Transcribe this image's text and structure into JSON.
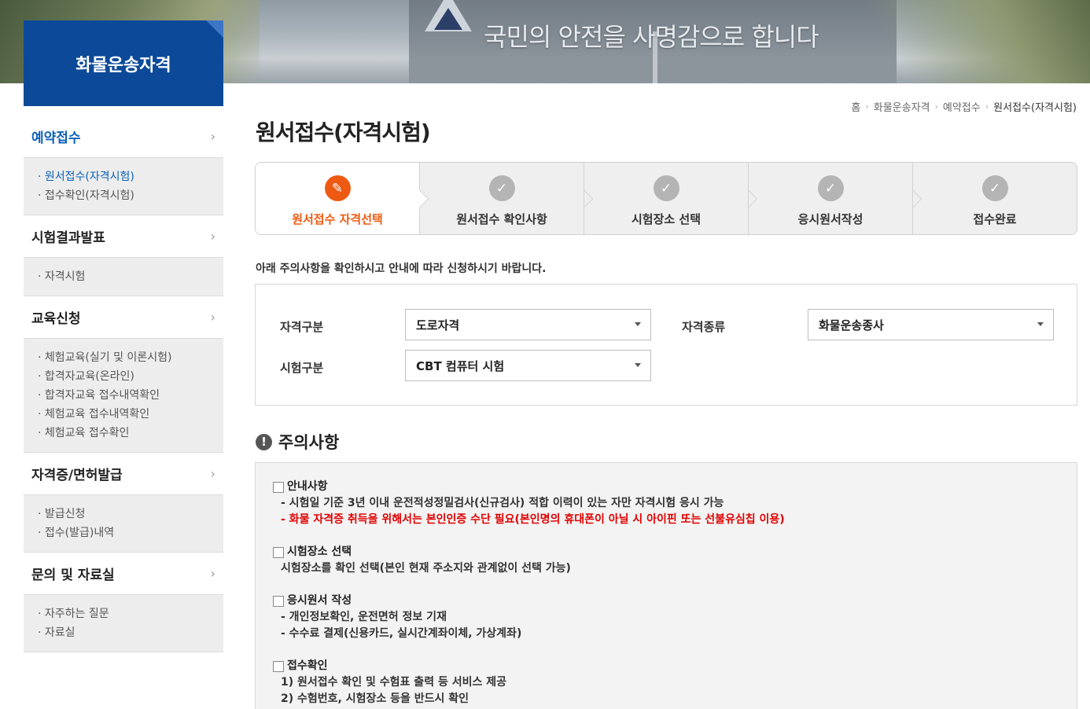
{
  "banner": {
    "slogan": "국민의 안전을 사명감으로 합니다"
  },
  "sidebar": {
    "title": "화물운송자격",
    "sections": [
      {
        "label": "예약접수",
        "items": [
          "원서접수(자격시험)",
          "접수확인(자격시험)"
        ]
      },
      {
        "label": "시험결과발표",
        "items": [
          "자격시험"
        ]
      },
      {
        "label": "교육신청",
        "items": [
          "체험교육(실기 및 이론시험)",
          "합격자교육(온라인)",
          "합격자교육 접수내역확인",
          "체험교육 접수내역확인",
          "체험교육 접수확인"
        ]
      },
      {
        "label": "자격증/면허발급",
        "items": [
          "발급신청",
          "접수(발급)내역"
        ]
      },
      {
        "label": "문의 및 자료실",
        "items": [
          "자주하는 질문",
          "자료실"
        ]
      }
    ]
  },
  "breadcrumb": [
    "홈",
    "화물운송자격",
    "예약접수",
    "원서접수(자격시험)"
  ],
  "page": {
    "title": "원서접수(자격시험)"
  },
  "steps": [
    {
      "label": "원서접수 자격선택",
      "icon": "pencil-icon"
    },
    {
      "label": "원서접수 확인사항",
      "icon": "check-icon"
    },
    {
      "label": "시험장소 선택",
      "icon": "check-icon"
    },
    {
      "label": "응시원서작성",
      "icon": "check-icon"
    },
    {
      "label": "접수완료",
      "icon": "check-icon"
    }
  ],
  "notice": "아래 주의사항을 확인하시고 안내에 따라 신청하시기 바랍니다.",
  "form": {
    "qual_type_label": "자격구분",
    "qual_type_value": "도로자격",
    "qual_kind_label": "자격종류",
    "qual_kind_value": "화물운송종사",
    "exam_type_label": "시험구분",
    "exam_type_value": "CBT 컴퓨터 시험"
  },
  "caution": {
    "title": "주의사항",
    "items": [
      {
        "head": "안내사항",
        "lines": [
          "- 시험일 기준 3년 이내 운전적성정밀검사(신규검사) 적합 이력이 있는 자만 자격시험 응시 가능"
        ],
        "red": "- 화물 자격증 취득을 위해서는 본인인증 수단 필요(본인명의 휴대폰이 아닐 시 아이핀 또는 선불유심칩 이용)"
      },
      {
        "head": "시험장소 선택",
        "lines": [
          "시험장소를 확인 선택(본인 현재 주소지와 관계없이 선택 가능)"
        ]
      },
      {
        "head": "응시원서 작성",
        "lines": [
          "- 개인정보확인, 운전면허 정보 기재",
          "- 수수료 결제(신용카드, 실시간계좌이체, 가상계좌)"
        ]
      },
      {
        "head": "접수확인",
        "lines": [
          "1) 원서접수 확인 및 수험표 출력 등 서비스 제공",
          "2) 수험번호, 시험장소 등을 반드시 확인"
        ]
      }
    ]
  },
  "colors": {
    "brand": "#0c4a99",
    "accent": "#ee5a12",
    "link_active": "#0c62b8",
    "warning": "#e00000"
  }
}
